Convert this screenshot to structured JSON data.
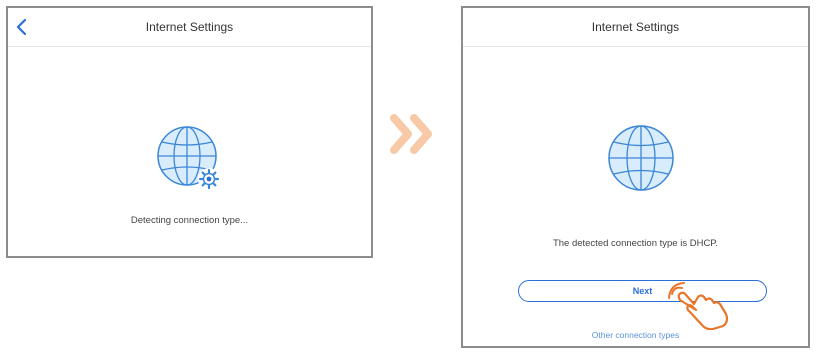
{
  "left_screen": {
    "title": "Internet Settings",
    "status_text": "Detecting connection type..."
  },
  "right_screen": {
    "title": "Internet Settings",
    "status_text": "The detected connection type is DHCP.",
    "next_label": "Next",
    "other_link": "Other connection types"
  },
  "colors": {
    "accent": "#2a6fd6",
    "globe_fill": "#d8ecfb",
    "globe_stroke": "#3b86d6",
    "arrow": "#f7c9a6",
    "hand": "#e8762a"
  },
  "icons": [
    "back-icon",
    "globe-icon",
    "gear-icon",
    "double-chevron-icon",
    "pointer-hand-icon"
  ]
}
